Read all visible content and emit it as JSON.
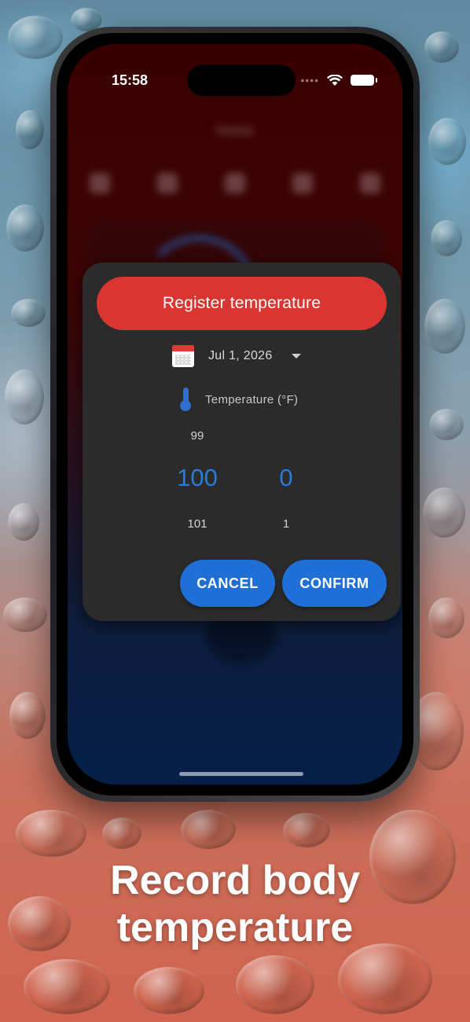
{
  "status_bar": {
    "time": "15:58"
  },
  "blurred_app": {
    "title": "Home"
  },
  "dialog": {
    "header": "Register temperature",
    "date": "Jul 1, 2026",
    "temperature_label": "Temperature (°F)",
    "picker_whole": {
      "above": "99",
      "selected": "100",
      "below": "101"
    },
    "picker_decimal": {
      "selected": "0",
      "below": "1"
    },
    "cancel_label": "CANCEL",
    "confirm_label": "CONFIRM"
  },
  "caption": {
    "line1": "Record body",
    "line2": "temperature"
  },
  "colors": {
    "header_red": "#d93632",
    "button_blue": "#1f6fd6",
    "picker_blue": "#2a7ad8",
    "dialog_bg": "#2b2b2b"
  },
  "icons": [
    "calendar-icon",
    "thermometer-icon",
    "dropdown-caret-icon",
    "wifi-icon",
    "battery-icon"
  ]
}
